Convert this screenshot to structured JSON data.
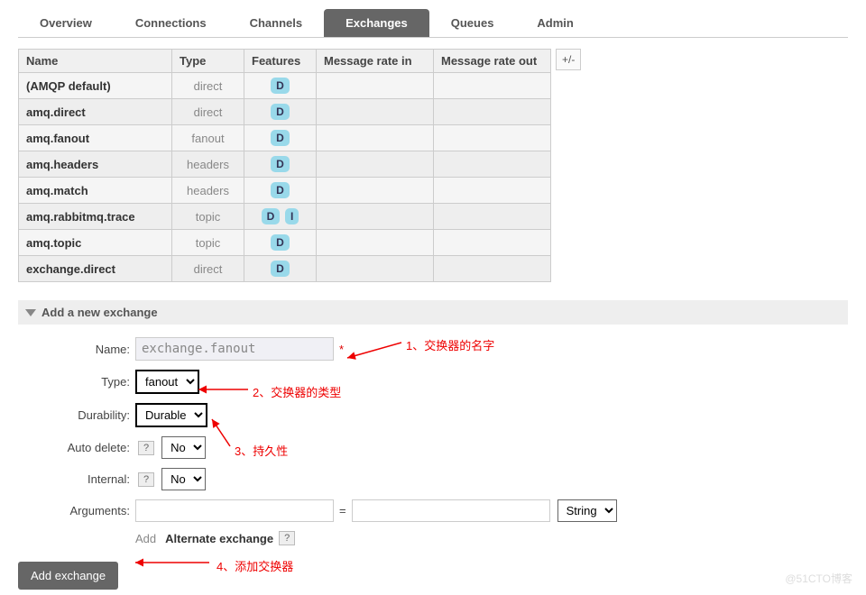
{
  "tabs": [
    {
      "label": "Overview"
    },
    {
      "label": "Connections"
    },
    {
      "label": "Channels"
    },
    {
      "label": "Exchanges",
      "active": true
    },
    {
      "label": "Queues"
    },
    {
      "label": "Admin"
    }
  ],
  "table": {
    "headers": [
      "Name",
      "Type",
      "Features",
      "Message rate in",
      "Message rate out"
    ],
    "plusminus": "+/-",
    "rows": [
      {
        "name": "(AMQP default)",
        "type": "direct",
        "features": [
          "D"
        ]
      },
      {
        "name": "amq.direct",
        "type": "direct",
        "features": [
          "D"
        ]
      },
      {
        "name": "amq.fanout",
        "type": "fanout",
        "features": [
          "D"
        ]
      },
      {
        "name": "amq.headers",
        "type": "headers",
        "features": [
          "D"
        ]
      },
      {
        "name": "amq.match",
        "type": "headers",
        "features": [
          "D"
        ]
      },
      {
        "name": "amq.rabbitmq.trace",
        "type": "topic",
        "features": [
          "D",
          "I"
        ]
      },
      {
        "name": "amq.topic",
        "type": "topic",
        "features": [
          "D"
        ]
      },
      {
        "name": "exchange.direct",
        "type": "direct",
        "features": [
          "D"
        ]
      }
    ]
  },
  "section_title": "Add a new exchange",
  "form": {
    "name_label": "Name:",
    "name_value": "exchange.fanout",
    "type_label": "Type:",
    "type_value": "fanout",
    "durability_label": "Durability:",
    "durability_value": "Durable",
    "autodelete_label": "Auto delete:",
    "autodelete_value": "No",
    "internal_label": "Internal:",
    "internal_value": "No",
    "arguments_label": "Arguments:",
    "arg_type_value": "String",
    "add_text": "Add",
    "alt_exchange": "Alternate exchange",
    "help": "?",
    "submit": "Add exchange"
  },
  "annotations": {
    "a1": "1、交换器的名字",
    "a2": "2、交换器的类型",
    "a3": "3、持久性",
    "a4": "4、添加交换器"
  },
  "watermark": "@51CTO博客"
}
